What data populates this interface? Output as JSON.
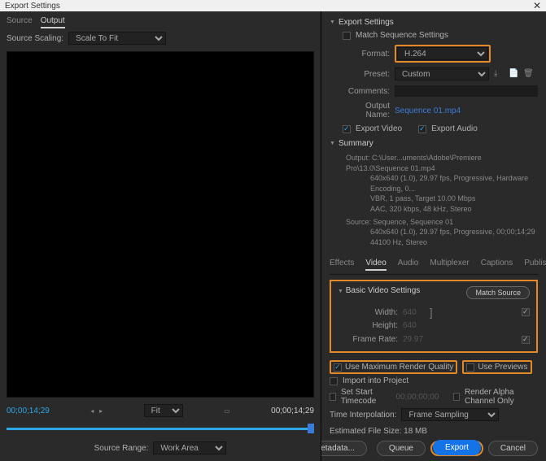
{
  "title": "Export Settings",
  "leftPanel": {
    "tabs": {
      "source": "Source",
      "output": "Output"
    },
    "scaling": {
      "label": "Source Scaling:",
      "value": "Scale To Fit"
    },
    "fit": "Fit",
    "timecodeIn": "00;00;14;29",
    "timecodeOut": "00;00;14;29",
    "sourceRangeLabel": "Source Range:",
    "sourceRangeValue": "Work Area"
  },
  "exportSettings": {
    "header": "Export Settings",
    "matchSequence": "Match Sequence Settings",
    "formatLabel": "Format:",
    "formatValue": "H.264",
    "presetLabel": "Preset:",
    "presetValue": "Custom",
    "commentsLabel": "Comments:",
    "outputNameLabel": "Output Name:",
    "outputNameValue": "Sequence 01.mp4",
    "exportVideo": "Export Video",
    "exportAudio": "Export Audio"
  },
  "summary": {
    "header": "Summary",
    "outputLabel": "Output:",
    "outputLine1": "C:\\User...uments\\Adobe\\Premiere Pro\\13.0\\Sequence 01.mp4",
    "outputLine2": "640x640 (1.0), 29.97 fps, Progressive, Hardware Encoding, 0...",
    "outputLine3": "VBR, 1 pass, Target 10.00 Mbps",
    "outputLine4": "AAC, 320 kbps, 48 kHz, Stereo",
    "sourceLabel": "Source:",
    "sourceLine1": "Sequence, Sequence 01",
    "sourceLine2": "640x640 (1.0), 29.97 fps, Progressive, 00;00;14;29",
    "sourceLine3": "44100 Hz, Stereo"
  },
  "midTabs": {
    "effects": "Effects",
    "video": "Video",
    "audio": "Audio",
    "multiplexer": "Multiplexer",
    "captions": "Captions",
    "publish": "Publish"
  },
  "bvs": {
    "header": "Basic Video Settings",
    "matchSource": "Match Source",
    "widthLabel": "Width:",
    "widthValue": "640",
    "heightLabel": "Height:",
    "heightValue": "640",
    "frameRateLabel": "Frame Rate:",
    "frameRateValue": "29.97"
  },
  "options": {
    "maxQuality": "Use Maximum Render Quality",
    "usePreviews": "Use Previews",
    "importProject": "Import into Project",
    "setStartTC": "Set Start Timecode",
    "startTCValue": "00;00;00;00",
    "renderAlpha": "Render Alpha Channel Only",
    "timeInterpLabel": "Time Interpolation:",
    "timeInterpValue": "Frame Sampling",
    "estLabel": "Estimated File Size:",
    "estValue": "18 MB"
  },
  "buttons": {
    "metadata": "Metadata...",
    "queue": "Queue",
    "export": "Export",
    "cancel": "Cancel"
  }
}
